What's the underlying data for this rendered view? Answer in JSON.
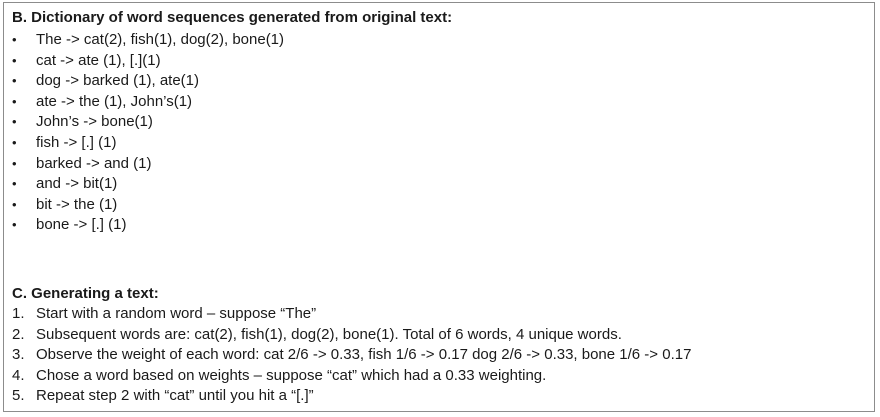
{
  "section_b": {
    "heading": "B. Dictionary of word sequences generated from original text:",
    "bullet": "•",
    "items": [
      "The -> cat(2), fish(1), dog(2), bone(1)",
      "cat -> ate (1), [.](1)",
      "dog -> barked (1), ate(1)",
      "ate -> the (1), John’s(1)",
      "John’s -> bone(1)",
      "fish -> [.] (1)",
      "barked -> and (1)",
      "and -> bit(1)",
      "bit -> the (1)",
      "bone -> [.] (1)"
    ]
  },
  "section_c": {
    "heading": "C. Generating a text:",
    "steps": [
      {
        "num": "1.",
        "text": "Start with a random word – suppose “The”"
      },
      {
        "num": "2.",
        "text": "Subsequent words are: cat(2), fish(1), dog(2), bone(1).  Total of 6 words, 4 unique words."
      },
      {
        "num": "3.",
        "text": "Observe the weight of each word: cat 2/6 -> 0.33, fish 1/6 -> 0.17 dog 2/6 -> 0.33, bone 1/6 -> 0.17"
      },
      {
        "num": "4.",
        "text": "Chose a word based on weights – suppose “cat” which had a 0.33 weighting."
      },
      {
        "num": "5.",
        "text": "Repeat step 2 with “cat” until you hit a “[.]”"
      }
    ]
  }
}
